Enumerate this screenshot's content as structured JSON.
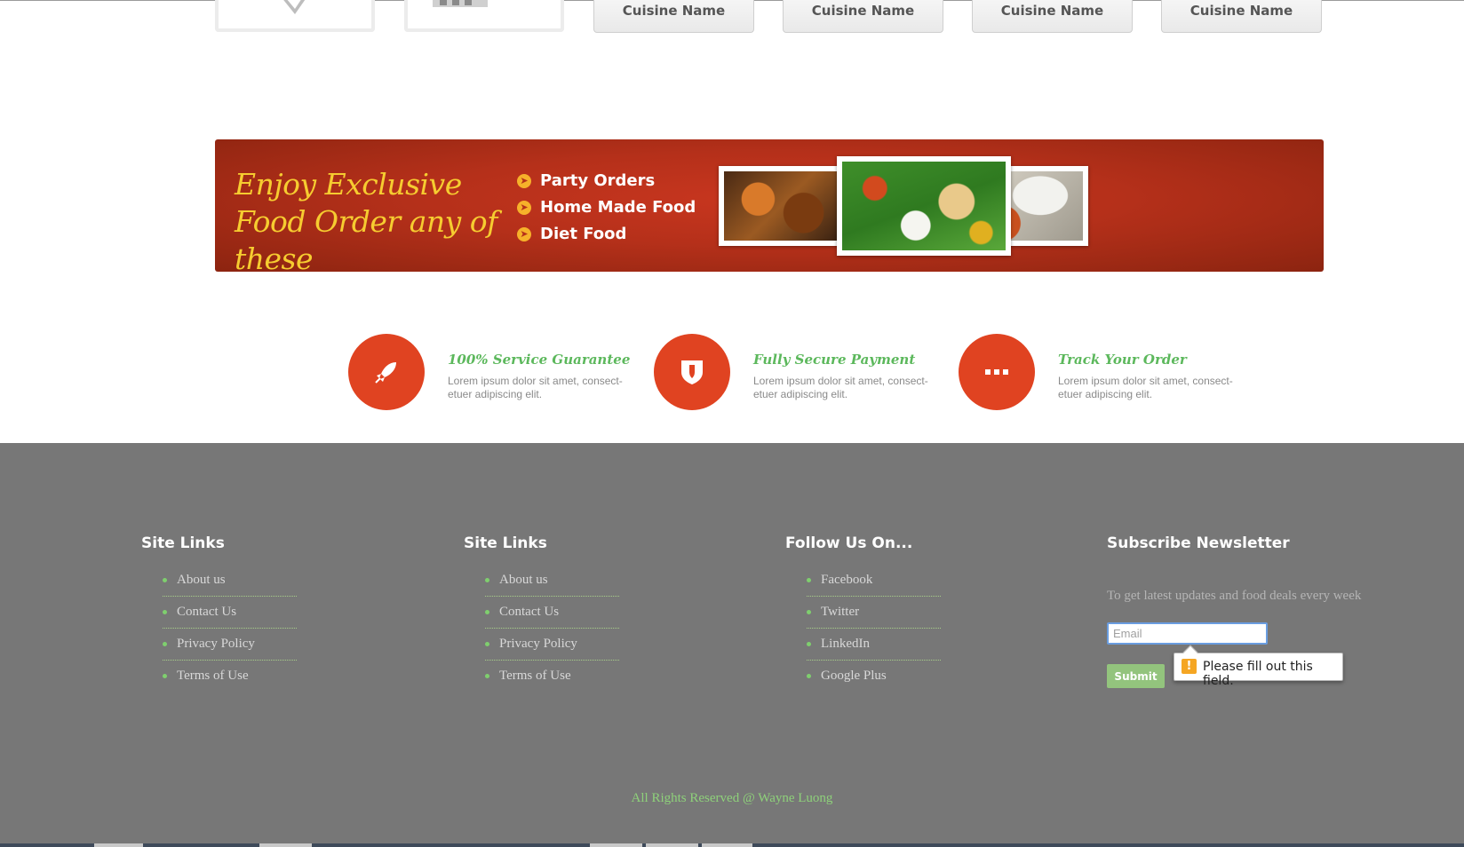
{
  "cuisines": {
    "tiles": [
      "Cuisine Name",
      "Cuisine Name",
      "Cuisine Name",
      "Cuisine Name"
    ]
  },
  "banner": {
    "title": "Enjoy Exclusive Food Order any of these",
    "items": [
      "Party Orders",
      "Home Made Food",
      "Diet Food"
    ]
  },
  "features": [
    {
      "icon": "rocket-icon",
      "title": "100% Service Guarantee",
      "text": "Lorem ipsum dolor sit amet, consect-etuer adipiscing elit."
    },
    {
      "icon": "shield-icon",
      "title": "Fully Secure Payment",
      "text": "Lorem ipsum dolor sit amet, consect-etuer adipiscing elit."
    },
    {
      "icon": "ellipsis-icon",
      "title": "Track Your Order",
      "text": "Lorem ipsum dolor sit amet, consect-etuer adipiscing elit."
    }
  ],
  "footer": {
    "columns": [
      {
        "heading": "Site Links",
        "links": [
          "About us",
          "Contact Us",
          "Privacy Policy",
          "Terms of Use"
        ]
      },
      {
        "heading": "Site Links",
        "links": [
          "About us",
          "Contact Us",
          "Privacy Policy",
          "Terms of Use"
        ]
      },
      {
        "heading": "Follow Us On...",
        "links": [
          "Facebook",
          "Twitter",
          "LinkedIn",
          "Google Plus"
        ]
      }
    ],
    "newsletter": {
      "heading": "Subscribe Newsletter",
      "text": "To get latest updates and food deals every week",
      "email_placeholder": "Email",
      "submit_label": "Submit",
      "validation_message": "Please fill out this field.",
      "warning_glyph": "!"
    },
    "copyright": "All Rights Reserved @ Wayne Luong"
  },
  "colors": {
    "accent_red": "#e04321",
    "accent_green": "#5cb85c",
    "banner_yellow": "#f6cc30",
    "footer_bg": "#777777"
  }
}
